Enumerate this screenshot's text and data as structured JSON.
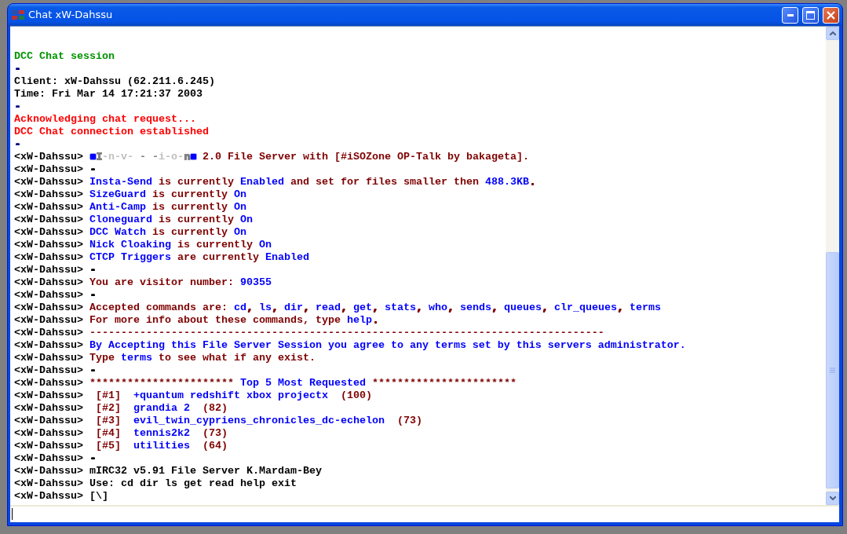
{
  "window": {
    "title": "Chat xW-Dahssu"
  },
  "log": [
    {
      "segments": [
        {
          "text": "DCC Chat session",
          "color": "#009300"
        }
      ]
    },
    {
      "segments": [
        {
          "text": "-",
          "color": "#00007f"
        }
      ]
    },
    {
      "segments": [
        {
          "text": "Client: xW-Dahssu (62.211.6.245)",
          "color": "#000000"
        }
      ]
    },
    {
      "segments": [
        {
          "text": "Time: Fri Mar 14 17:21:37 2003",
          "color": "#000000"
        }
      ]
    },
    {
      "segments": [
        {
          "text": "-",
          "color": "#00007f"
        }
      ]
    },
    {
      "segments": [
        {
          "text": "Acknowledging chat request...",
          "color": "#ff0000"
        }
      ]
    },
    {
      "segments": [
        {
          "text": "DCC Chat connection established",
          "color": "#ff0000"
        }
      ]
    },
    {
      "segments": [
        {
          "text": "-",
          "color": "#00007f"
        }
      ]
    },
    {
      "segments": [
        {
          "text": "<xW-Dahssu> ",
          "color": "#000000"
        },
        {
          "text": "■",
          "color": "#0000fc"
        },
        {
          "text": "I",
          "color": "#7f7f7f"
        },
        {
          "text": "-n-v-",
          "color": "#c0c0c0"
        },
        {
          "text": " - -",
          "color": "#7f7f7f"
        },
        {
          "text": "i-o-",
          "color": "#c0c0c0"
        },
        {
          "text": "n",
          "color": "#7f7f7f"
        },
        {
          "text": "■",
          "color": "#0000fc"
        },
        {
          "text": " 2.0 File Server with [#iSOZone OP-Talk by bakageta].",
          "color": "#7f0000"
        }
      ]
    },
    {
      "segments": [
        {
          "text": "<xW-Dahssu> ",
          "color": "#000000"
        },
        {
          "text": "-",
          "color": "#000000"
        }
      ]
    },
    {
      "segments": [
        {
          "text": "<xW-Dahssu> ",
          "color": "#000000"
        },
        {
          "text": "Insta-Send",
          "color": "#0000fc"
        },
        {
          "text": " is currently ",
          "color": "#7f0000"
        },
        {
          "text": "Enabled",
          "color": "#0000fc"
        },
        {
          "text": " and set for files smaller then ",
          "color": "#7f0000"
        },
        {
          "text": "488.3KB",
          "color": "#0000fc"
        },
        {
          "text": ".",
          "color": "#7f0000"
        }
      ]
    },
    {
      "segments": [
        {
          "text": "<xW-Dahssu> ",
          "color": "#000000"
        },
        {
          "text": "SizeGuard",
          "color": "#0000fc"
        },
        {
          "text": " is currently ",
          "color": "#7f0000"
        },
        {
          "text": "On",
          "color": "#0000fc"
        }
      ]
    },
    {
      "segments": [
        {
          "text": "<xW-Dahssu> ",
          "color": "#000000"
        },
        {
          "text": "Anti-Camp",
          "color": "#0000fc"
        },
        {
          "text": " is currently ",
          "color": "#7f0000"
        },
        {
          "text": "On",
          "color": "#0000fc"
        }
      ]
    },
    {
      "segments": [
        {
          "text": "<xW-Dahssu> ",
          "color": "#000000"
        },
        {
          "text": "Cloneguard",
          "color": "#0000fc"
        },
        {
          "text": " is currently ",
          "color": "#7f0000"
        },
        {
          "text": "On",
          "color": "#0000fc"
        }
      ]
    },
    {
      "segments": [
        {
          "text": "<xW-Dahssu> ",
          "color": "#000000"
        },
        {
          "text": "DCC Watch",
          "color": "#0000fc"
        },
        {
          "text": " is currently ",
          "color": "#7f0000"
        },
        {
          "text": "On",
          "color": "#0000fc"
        }
      ]
    },
    {
      "segments": [
        {
          "text": "<xW-Dahssu> ",
          "color": "#000000"
        },
        {
          "text": "Nick Cloaking",
          "color": "#0000fc"
        },
        {
          "text": " is currently ",
          "color": "#7f0000"
        },
        {
          "text": "On",
          "color": "#0000fc"
        }
      ]
    },
    {
      "segments": [
        {
          "text": "<xW-Dahssu> ",
          "color": "#000000"
        },
        {
          "text": "CTCP Triggers",
          "color": "#0000fc"
        },
        {
          "text": " are currently ",
          "color": "#7f0000"
        },
        {
          "text": "Enabled",
          "color": "#0000fc"
        }
      ]
    },
    {
      "segments": [
        {
          "text": "<xW-Dahssu> ",
          "color": "#000000"
        },
        {
          "text": "-",
          "color": "#000000"
        }
      ]
    },
    {
      "segments": [
        {
          "text": "<xW-Dahssu> ",
          "color": "#000000"
        },
        {
          "text": "You are visitor number: ",
          "color": "#7f0000"
        },
        {
          "text": "90355",
          "color": "#0000fc"
        }
      ]
    },
    {
      "segments": [
        {
          "text": "<xW-Dahssu> ",
          "color": "#000000"
        },
        {
          "text": "-",
          "color": "#000000"
        }
      ]
    },
    {
      "segments": [
        {
          "text": "<xW-Dahssu> ",
          "color": "#000000"
        },
        {
          "text": "Accepted commands are: ",
          "color": "#7f0000"
        },
        {
          "text": "cd",
          "color": "#0000fc"
        },
        {
          "text": ", ",
          "color": "#7f0000"
        },
        {
          "text": "ls",
          "color": "#0000fc"
        },
        {
          "text": ", ",
          "color": "#7f0000"
        },
        {
          "text": "dir",
          "color": "#0000fc"
        },
        {
          "text": ", ",
          "color": "#7f0000"
        },
        {
          "text": "read",
          "color": "#0000fc"
        },
        {
          "text": ", ",
          "color": "#7f0000"
        },
        {
          "text": "get",
          "color": "#0000fc"
        },
        {
          "text": ", ",
          "color": "#7f0000"
        },
        {
          "text": "stats",
          "color": "#0000fc"
        },
        {
          "text": ", ",
          "color": "#7f0000"
        },
        {
          "text": "who",
          "color": "#0000fc"
        },
        {
          "text": ", ",
          "color": "#7f0000"
        },
        {
          "text": "sends",
          "color": "#0000fc"
        },
        {
          "text": ", ",
          "color": "#7f0000"
        },
        {
          "text": "queues",
          "color": "#0000fc"
        },
        {
          "text": ", ",
          "color": "#7f0000"
        },
        {
          "text": "clr_queues",
          "color": "#0000fc"
        },
        {
          "text": ", ",
          "color": "#7f0000"
        },
        {
          "text": "terms",
          "color": "#0000fc"
        }
      ]
    },
    {
      "segments": [
        {
          "text": "<xW-Dahssu> ",
          "color": "#000000"
        },
        {
          "text": "For more info about these commands, type ",
          "color": "#7f0000"
        },
        {
          "text": "help",
          "color": "#0000fc"
        },
        {
          "text": ".",
          "color": "#7f0000"
        }
      ]
    },
    {
      "segments": [
        {
          "text": "<xW-Dahssu> ",
          "color": "#000000"
        },
        {
          "text": "----------------------------------------------------------------------------------",
          "color": "#7f0000"
        }
      ]
    },
    {
      "segments": [
        {
          "text": "<xW-Dahssu> ",
          "color": "#000000"
        },
        {
          "text": "By Accepting this File Server Session you agree to any terms set by this servers administrator.",
          "color": "#0000fc"
        }
      ]
    },
    {
      "segments": [
        {
          "text": "<xW-Dahssu> ",
          "color": "#000000"
        },
        {
          "text": "Type ",
          "color": "#7f0000"
        },
        {
          "text": "terms",
          "color": "#0000fc"
        },
        {
          "text": " to see what if any exist.",
          "color": "#7f0000"
        }
      ]
    },
    {
      "segments": [
        {
          "text": "<xW-Dahssu> ",
          "color": "#000000"
        },
        {
          "text": "-",
          "color": "#000000"
        }
      ]
    },
    {
      "segments": [
        {
          "text": "<xW-Dahssu> ",
          "color": "#000000"
        },
        {
          "text": "*********************** ",
          "color": "#7f0000"
        },
        {
          "text": "Top 5 Most Requested",
          "color": "#0000fc"
        },
        {
          "text": " ***********************",
          "color": "#7f0000"
        }
      ]
    },
    {
      "segments": [
        {
          "text": "<xW-Dahssu> ",
          "color": "#000000"
        },
        {
          "text": " [#1]  ",
          "color": "#7f0000"
        },
        {
          "text": "+quantum redshift xbox projectx",
          "color": "#0000fc"
        },
        {
          "text": "  (100)",
          "color": "#7f0000"
        }
      ]
    },
    {
      "segments": [
        {
          "text": "<xW-Dahssu> ",
          "color": "#000000"
        },
        {
          "text": " [#2]  ",
          "color": "#7f0000"
        },
        {
          "text": "grandia 2",
          "color": "#0000fc"
        },
        {
          "text": "  (82)",
          "color": "#7f0000"
        }
      ]
    },
    {
      "segments": [
        {
          "text": "<xW-Dahssu> ",
          "color": "#000000"
        },
        {
          "text": " [#3]  ",
          "color": "#7f0000"
        },
        {
          "text": "evil_twin_cypriens_chronicles_dc-echelon",
          "color": "#0000fc"
        },
        {
          "text": "  (73)",
          "color": "#7f0000"
        }
      ]
    },
    {
      "segments": [
        {
          "text": "<xW-Dahssu> ",
          "color": "#000000"
        },
        {
          "text": " [#4]  ",
          "color": "#7f0000"
        },
        {
          "text": "tennis2k2",
          "color": "#0000fc"
        },
        {
          "text": "  (73)",
          "color": "#7f0000"
        }
      ]
    },
    {
      "segments": [
        {
          "text": "<xW-Dahssu> ",
          "color": "#000000"
        },
        {
          "text": " [#5]  ",
          "color": "#7f0000"
        },
        {
          "text": "utilities",
          "color": "#0000fc"
        },
        {
          "text": "  (64)",
          "color": "#7f0000"
        }
      ]
    },
    {
      "segments": [
        {
          "text": "<xW-Dahssu> ",
          "color": "#000000"
        },
        {
          "text": "-",
          "color": "#000000"
        }
      ]
    },
    {
      "segments": [
        {
          "text": "<xW-Dahssu> ",
          "color": "#000000"
        },
        {
          "text": "mIRC32 v5.91 File Server K.Mardam-Bey",
          "color": "#000000"
        }
      ]
    },
    {
      "segments": [
        {
          "text": "<xW-Dahssu> ",
          "color": "#000000"
        },
        {
          "text": "Use: cd dir ls get read help exit",
          "color": "#000000"
        }
      ]
    },
    {
      "segments": [
        {
          "text": "<xW-Dahssu> ",
          "color": "#000000"
        },
        {
          "text": "[\\]",
          "color": "#000000"
        }
      ]
    }
  ]
}
